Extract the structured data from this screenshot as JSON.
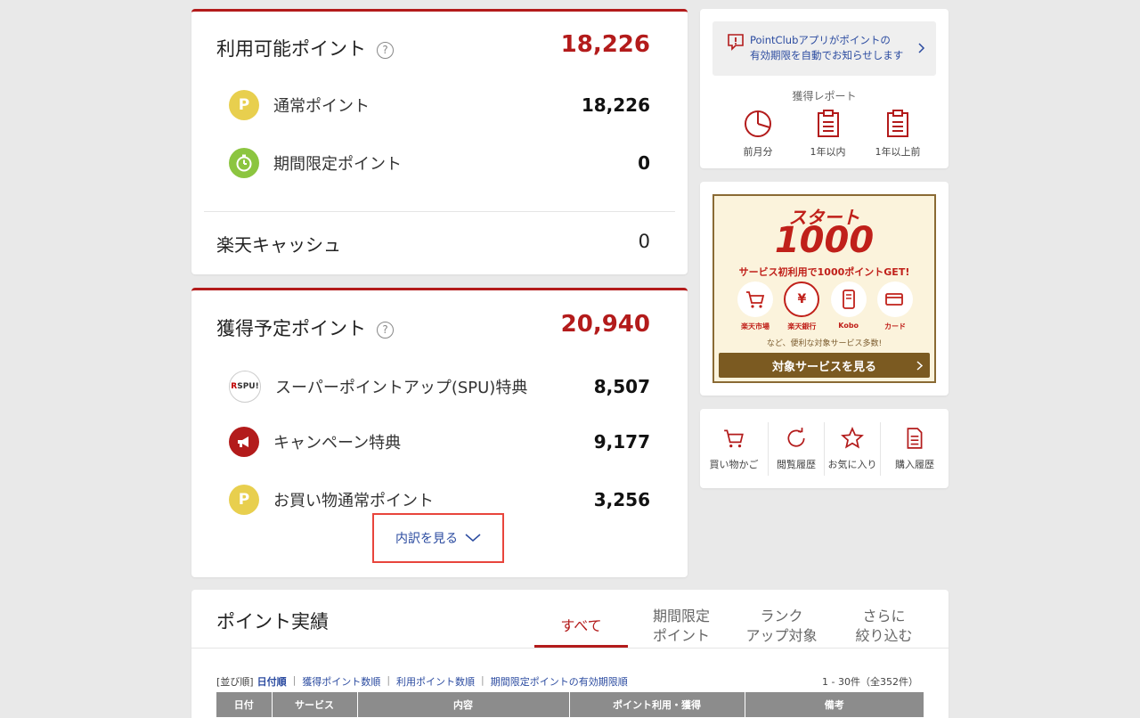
{
  "available": {
    "title": "利用可能ポイント",
    "help": "?",
    "total": "18,226",
    "rows": [
      {
        "label": "通常ポイント",
        "value": "18,226",
        "icon": "P"
      },
      {
        "label": "期間限定ポイント",
        "value": "0"
      }
    ],
    "cash_label": "楽天キャッシュ",
    "cash_value": "0"
  },
  "scheduled": {
    "title": "獲得予定ポイント",
    "help": "?",
    "total": "20,940",
    "rows": [
      {
        "label": "スーパーポイントアップ(SPU)特典",
        "value": "8,507",
        "icon_r": "R",
        "icon_text": "SPU!"
      },
      {
        "label": "キャンペーン特典",
        "value": "9,177"
      },
      {
        "label": "お買い物通常ポイント",
        "value": "3,256",
        "icon": "P"
      }
    ],
    "details_link": "内訳を見る"
  },
  "notice": {
    "line1": "PointClubアプリがポイントの",
    "line2": "有効期限を自動でお知らせします"
  },
  "report": {
    "title": "獲得レポート",
    "items": [
      {
        "label": "前月分",
        "icon": "pie-chart-icon"
      },
      {
        "label": "1年以内",
        "icon": "clipboard-icon"
      },
      {
        "label": "1年以上前",
        "icon": "clipboard-icon"
      }
    ]
  },
  "banner": {
    "start": "スタート",
    "number": "1000",
    "subtitle": "サービス初利用で1000ポイントGET!",
    "services": [
      {
        "label": "楽天市場",
        "icon": "cart-icon"
      },
      {
        "label": "楽天銀行",
        "icon": "wallet-icon",
        "glyph": "¥"
      },
      {
        "label": "Kobo",
        "icon": "ebook-icon"
      },
      {
        "label": "カード",
        "icon": "credit-card-icon"
      }
    ],
    "note": "など、便利な対象サービス多数!",
    "button": "対象サービスを見る"
  },
  "quicklinks": [
    {
      "label": "買い物かご",
      "icon": "cart-icon"
    },
    {
      "label": "閲覧履歴",
      "icon": "history-icon"
    },
    {
      "label": "お気に入り",
      "icon": "star-icon"
    },
    {
      "label": "購入履歴",
      "icon": "document-icon"
    }
  ],
  "history": {
    "title": "ポイント実績",
    "tabs": [
      {
        "line1": "すべて",
        "line2": ""
      },
      {
        "line1": "期間限定",
        "line2": "ポイント"
      },
      {
        "line1": "ランク",
        "line2": "アップ対象"
      },
      {
        "line1": "さらに",
        "line2": "絞り込む"
      }
    ],
    "sort_prefix": "[並び順]",
    "sort_options": [
      "日付順",
      "獲得ポイント数順",
      "利用ポイント数順",
      "期間限定ポイントの有効期限順"
    ],
    "count": "1 - 30件（全352件）",
    "columns": [
      "日付",
      "サービス",
      "内容",
      "ポイント利用・獲得",
      "備考"
    ]
  },
  "colors": {
    "accent": "#b31b1b",
    "highlight_box": "#e8453c",
    "link": "#2b4ba0"
  }
}
